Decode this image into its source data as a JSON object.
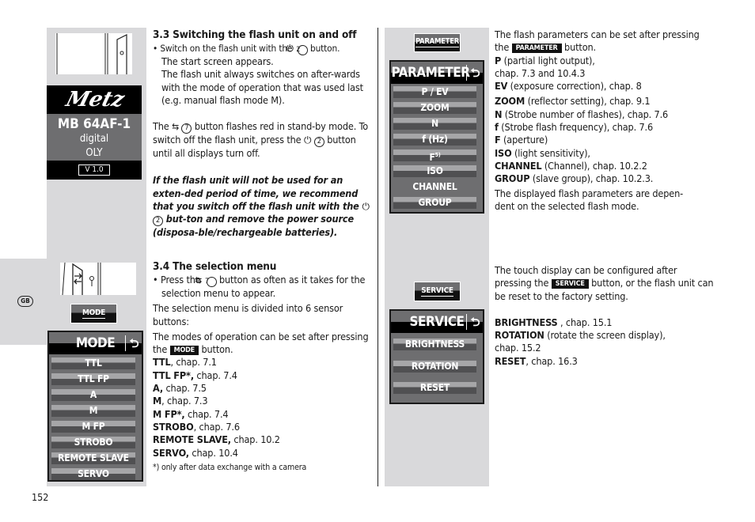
{
  "page": {
    "page_number": "152",
    "language_badge": "GB"
  },
  "left_panel": {
    "start_screen": {
      "brand": "Metz",
      "model": "MB 64AF-1",
      "line1": "digital",
      "line2": "OLY",
      "version": "V 1.0"
    },
    "mode_soft_button": "MODE",
    "mode_screen": {
      "title": "MODE",
      "back_icon": "⮌",
      "items": [
        "TTL",
        "TTL FP",
        "A",
        "M",
        "M FP",
        "STROBO",
        "REMOTE SLAVE",
        "SERVO"
      ]
    }
  },
  "section_3_3": {
    "heading": "3.3 Switching the flash unit on and off",
    "bullet_pre": "Switch on the flash unit with the",
    "bullet_post": "button.",
    "para1": "The start screen appears.",
    "para2": "The flash unit always switches on after-wards with the mode of operation that was used last (e.g. manual flash mode M).",
    "standby_pre": "The",
    "standby_mid": "button flashes red in stand-by mode. To switch off the flash unit, press the",
    "standby_post": "button until all displays turn off.",
    "warning_pre": "If the flash unit will not be used for an exten-ded period of time, we recommend that you switch off the flash unit with the",
    "warning_post": "but-ton and remove the power source (disposa-ble/rechargeable batteries).",
    "power_symbol": "⏻",
    "num2": "2",
    "switch_symbol": "⇆",
    "num7": "7"
  },
  "section_3_4": {
    "heading": "3.4 The selection menu",
    "bullet_pre": "Press the",
    "bullet_post": "button as often as it takes for the selection menu to appear.",
    "para1": "The selection menu is divided into 6 sensor buttons:",
    "modes_pre": "The modes of operation can be set after pressing the",
    "modes_chip": "MODE",
    "modes_post": "button.",
    "entries": [
      {
        "bold": "TTL",
        "rest": ", chap. 7.1"
      },
      {
        "bold": "TTL FP*,",
        "rest": " chap. 7.4"
      },
      {
        "bold": "A,",
        "rest": " chap. 7.5"
      },
      {
        "bold": "M",
        "rest": ", chap. 7.3"
      },
      {
        "bold": "M FP*,",
        "rest": "  chap. 7.4"
      },
      {
        "bold": "STROBO",
        "rest": ", chap. 7.6"
      },
      {
        "bold": "REMOTE SLAVE,",
        "rest": " chap. 10.2"
      },
      {
        "bold": "SERVO,",
        "rest": " chap. 10.4"
      }
    ],
    "footnote": "*) only after data exchange with a camera"
  },
  "right_panel": {
    "parameter_soft_button": "PARAMETER",
    "parameter_screen": {
      "title": "PARAMETER",
      "items": [
        "P / EV",
        "ZOOM",
        "N",
        "f (Hz)",
        "F",
        "ISO",
        "CHANNEL",
        "GROUP"
      ],
      "f_superscript": "5)"
    },
    "service_soft_button": "SERVICE",
    "service_screen": {
      "title": "SERVICE",
      "items": [
        "BRIGHTNESS",
        "ROTATION",
        "RESET"
      ]
    }
  },
  "parameter_text": {
    "intro_pre": "The flash parameters can be set after pressing the",
    "chip": "PARAMETER",
    "intro_post": "button.",
    "entries": [
      {
        "bold": "P",
        "rest": " (partial light output),"
      },
      {
        "bold": "",
        "rest": "chap. 7.3 and 10.4.3"
      },
      {
        "bold": "EV",
        "rest": " (exposure correction), chap. 8"
      },
      {
        "bold": "ZOOM",
        "rest": " (reflector setting), chap. 9.1"
      },
      {
        "bold": "N",
        "rest": " (Strobe number of flashes), chap. 7.6"
      },
      {
        "bold": "f",
        "rest": " (Strobe flash frequency), chap. 7.6"
      },
      {
        "bold": "F",
        "rest": " (aperture)"
      },
      {
        "bold": "ISO",
        "rest": " (light sensitivity),"
      },
      {
        "bold": "CHANNEL",
        "rest": " (Channel), chap. 10.2.2"
      },
      {
        "bold": "GROUP",
        "rest": " (slave group), chap. 10.2.3."
      }
    ],
    "outro": "The displayed flash parameters are depen-dent on the selected flash mode."
  },
  "service_text": {
    "intro_pre": "The touch display can be configured after pressing the",
    "chip": "SERVICE",
    "intro_post": "button, or the flash unit can be reset to the factory setting.",
    "entries": [
      {
        "bold": "BRIGHTNESS",
        "rest": " , chap. 15.1"
      },
      {
        "bold": "ROTATION",
        "rest": " (rotate the screen display),"
      },
      {
        "bold": "",
        "rest": "chap. 15.2"
      },
      {
        "bold": "RESET",
        "rest": ", chap. 16.3"
      }
    ]
  }
}
